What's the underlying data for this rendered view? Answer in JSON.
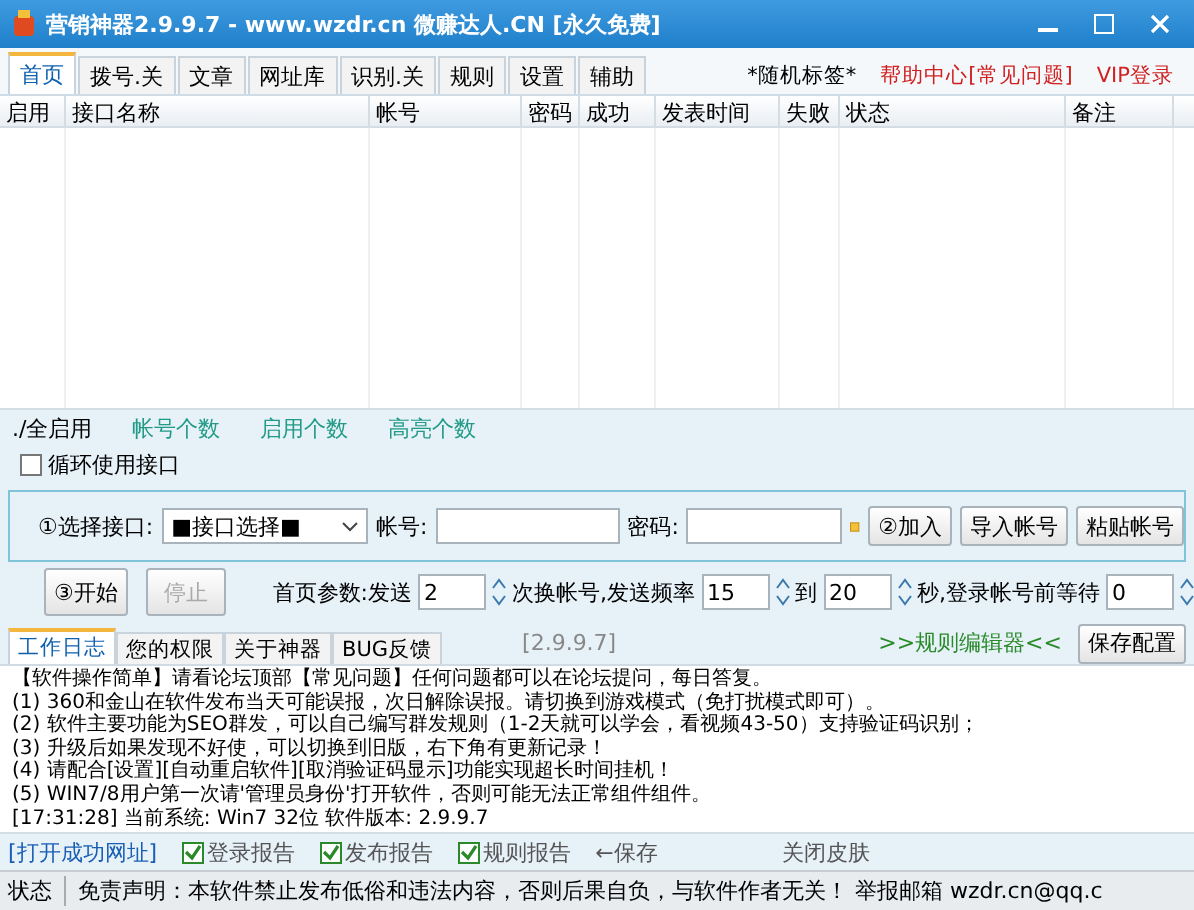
{
  "window": {
    "title": "营销神器2.9.9.7 - www.wzdr.cn 微赚达人.CN [永久免费]"
  },
  "tabs": [
    {
      "label": "首页",
      "selected": true
    },
    {
      "label": "拨号.关",
      "selected": false
    },
    {
      "label": "文章",
      "selected": false
    },
    {
      "label": "网址库",
      "selected": false
    },
    {
      "label": "识别.关",
      "selected": false
    },
    {
      "label": "规则",
      "selected": false
    },
    {
      "label": "设置",
      "selected": false
    },
    {
      "label": "辅助",
      "selected": false
    }
  ],
  "top_links": [
    {
      "label": "*随机标签*",
      "kind": "plain"
    },
    {
      "label": "帮助中心[常见问题]",
      "kind": "alert"
    },
    {
      "label": "VIP登录",
      "kind": "alert"
    }
  ],
  "table": {
    "columns": [
      "启用",
      "接口名称",
      "帐号",
      "密码",
      "成功",
      "发表时间",
      "失败",
      "状态",
      "备注"
    ]
  },
  "stats": [
    "./全启用",
    "帐号个数",
    "启用个数",
    "高亮个数"
  ],
  "loop_checkbox": {
    "label": "循环使用接口",
    "checked": false
  },
  "account_panel": {
    "interface_label": "①选择接口:",
    "interface_value": "■接口选择■",
    "account_label": "帐号:",
    "password_label": "密码:",
    "buttons": [
      "②加入",
      "导入帐号",
      "粘贴帐号"
    ]
  },
  "run": {
    "start": {
      "label": "③开始",
      "disabled": false
    },
    "stop": {
      "label": "停止",
      "disabled": true
    },
    "params": [
      {
        "label": "首页参数:发送",
        "value": "2"
      },
      {
        "label": "次换帐号,发送频率",
        "value": "15"
      },
      {
        "label": "到",
        "value": "20"
      },
      {
        "label": "秒,登录帐号前等待",
        "value": "0"
      }
    ]
  },
  "log_tabs": [
    {
      "label": "工作日志",
      "selected": true
    },
    {
      "label": "您的权限",
      "selected": false
    },
    {
      "label": "关于神器",
      "selected": false
    },
    {
      "label": "BUG反馈",
      "selected": false
    }
  ],
  "version": "[2.9.9.7]",
  "rule_editor": ">>规则编辑器<<",
  "save_config": "保存配置",
  "log": [
    "【软件操作简单】请看论坛顶部【常见问题】任何问题都可以在论坛提问，每日答复。",
    "(1) 360和金山在软件发布当天可能误报，次日解除误报。请切换到游戏模式（免打扰模式即可）。",
    "(2) 软件主要功能为SEO群发，可以自己编写群发规则（1-2天就可以学会，看视频43-50）支持验证码识别；",
    "(3) 升级后如果发现不好使，可以切换到旧版，右下角有更新记录！",
    "(4) 请配合[设置][自动重启软件][取消验证码显示]功能实现超长时间挂机！",
    "(5) WIN7/8用户第一次请'管理员身份'打开软件，否则可能无法正常组件组件。",
    "[17:31:28] 当前系统: Win7 32位 软件版本: 2.9.9.7"
  ],
  "bottom": {
    "open_link": "[打开成功网址]",
    "reports": [
      {
        "label": "登录报告",
        "checked": true
      },
      {
        "label": "发布报告",
        "checked": true
      },
      {
        "label": "规则报告",
        "checked": true
      }
    ],
    "save": "←保存",
    "skin": "关闭皮肤"
  },
  "status_bar": {
    "label": "状态",
    "text": "免责声明：本软件禁止发布低俗和违法内容，否则后果自负，与软件作者无关！ 举报邮箱 wzdr.cn@qq.c"
  }
}
